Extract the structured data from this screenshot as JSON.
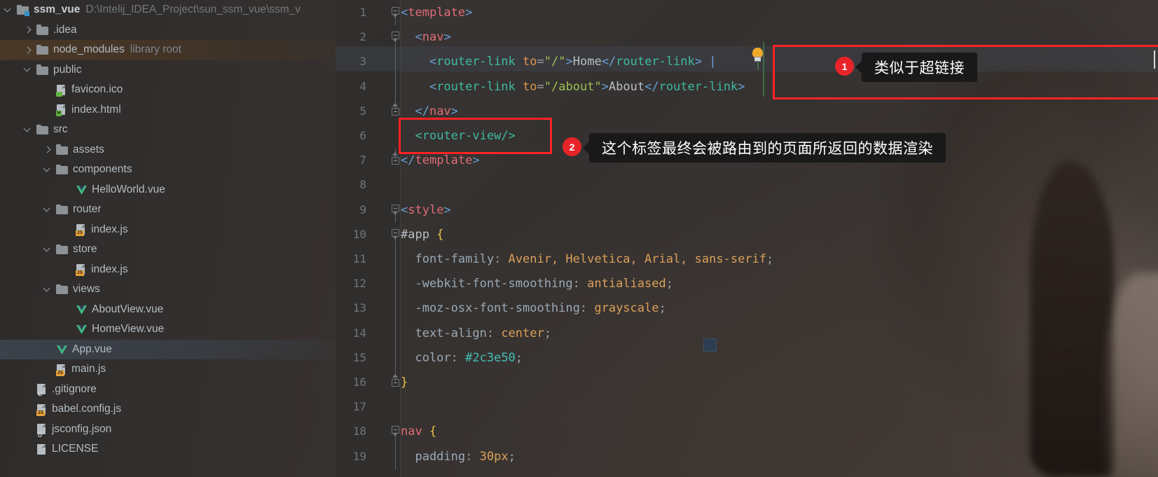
{
  "sidebar": {
    "items": [
      {
        "indent": 0,
        "arrow": "down",
        "icon": "module-folder-icon",
        "label": "ssm_vue",
        "bold": true,
        "path": "D:\\Intelij_IDEA_Project\\sun_ssm_vue\\ssm_v",
        "hint": "",
        "state": "normal"
      },
      {
        "indent": 1,
        "arrow": "right",
        "icon": "folder-icon",
        "label": ".idea",
        "bold": false,
        "path": "",
        "hint": "",
        "state": "normal"
      },
      {
        "indent": 1,
        "arrow": "right",
        "icon": "folder-icon",
        "label": "node_modules",
        "bold": false,
        "path": "",
        "hint": "library root",
        "state": "highlighted"
      },
      {
        "indent": 1,
        "arrow": "down",
        "icon": "folder-icon",
        "label": "public",
        "bold": false,
        "path": "",
        "hint": "",
        "state": "normal"
      },
      {
        "indent": 2,
        "arrow": "none",
        "icon": "image-file-icon",
        "label": "favicon.ico",
        "bold": false,
        "path": "",
        "hint": "",
        "state": "normal"
      },
      {
        "indent": 2,
        "arrow": "none",
        "icon": "html-file-icon",
        "label": "index.html",
        "bold": false,
        "path": "",
        "hint": "",
        "state": "normal"
      },
      {
        "indent": 1,
        "arrow": "down",
        "icon": "folder-icon",
        "label": "src",
        "bold": false,
        "path": "",
        "hint": "",
        "state": "normal"
      },
      {
        "indent": 2,
        "arrow": "right",
        "icon": "folder-icon",
        "label": "assets",
        "bold": false,
        "path": "",
        "hint": "",
        "state": "normal"
      },
      {
        "indent": 2,
        "arrow": "down",
        "icon": "folder-icon",
        "label": "components",
        "bold": false,
        "path": "",
        "hint": "",
        "state": "normal"
      },
      {
        "indent": 3,
        "arrow": "none",
        "icon": "vue-file-icon",
        "label": "HelloWorld.vue",
        "bold": false,
        "path": "",
        "hint": "",
        "state": "normal"
      },
      {
        "indent": 2,
        "arrow": "down",
        "icon": "folder-icon",
        "label": "router",
        "bold": false,
        "path": "",
        "hint": "",
        "state": "normal"
      },
      {
        "indent": 3,
        "arrow": "none",
        "icon": "js-file-icon",
        "label": "index.js",
        "bold": false,
        "path": "",
        "hint": "",
        "state": "normal"
      },
      {
        "indent": 2,
        "arrow": "down",
        "icon": "folder-icon",
        "label": "store",
        "bold": false,
        "path": "",
        "hint": "",
        "state": "normal"
      },
      {
        "indent": 3,
        "arrow": "none",
        "icon": "js-file-icon",
        "label": "index.js",
        "bold": false,
        "path": "",
        "hint": "",
        "state": "normal"
      },
      {
        "indent": 2,
        "arrow": "down",
        "icon": "folder-icon",
        "label": "views",
        "bold": false,
        "path": "",
        "hint": "",
        "state": "normal"
      },
      {
        "indent": 3,
        "arrow": "none",
        "icon": "vue-file-icon",
        "label": "AboutView.vue",
        "bold": false,
        "path": "",
        "hint": "",
        "state": "normal"
      },
      {
        "indent": 3,
        "arrow": "none",
        "icon": "vue-file-icon",
        "label": "HomeView.vue",
        "bold": false,
        "path": "",
        "hint": "",
        "state": "normal"
      },
      {
        "indent": 2,
        "arrow": "none",
        "icon": "vue-file-icon",
        "label": "App.vue",
        "bold": false,
        "path": "",
        "hint": "",
        "state": "selected"
      },
      {
        "indent": 2,
        "arrow": "none",
        "icon": "js-file-icon",
        "label": "main.js",
        "bold": false,
        "path": "",
        "hint": "",
        "state": "normal"
      },
      {
        "indent": 1,
        "arrow": "none",
        "icon": "gitignore-file-icon",
        "label": ".gitignore",
        "bold": false,
        "path": "",
        "hint": "",
        "state": "normal"
      },
      {
        "indent": 1,
        "arrow": "none",
        "icon": "js-file-icon",
        "label": "babel.config.js",
        "bold": false,
        "path": "",
        "hint": "",
        "state": "normal"
      },
      {
        "indent": 1,
        "arrow": "none",
        "icon": "json-file-icon",
        "label": "jsconfig.json",
        "bold": false,
        "path": "",
        "hint": "",
        "state": "normal"
      },
      {
        "indent": 1,
        "arrow": "none",
        "icon": "text-file-icon",
        "label": "LICENSE",
        "bold": false,
        "path": "",
        "hint": "",
        "state": "normal"
      }
    ]
  },
  "editor": {
    "filename": "App.vue",
    "lines": [
      {
        "n": "1",
        "fold": "start",
        "tokens": [
          {
            "t": "<",
            "c": "s-punct"
          },
          {
            "t": "template",
            "c": "s-tagpink"
          },
          {
            "t": ">",
            "c": "s-punct"
          }
        ]
      },
      {
        "n": "2",
        "fold": "start",
        "tokens": [
          {
            "t": "  <",
            "c": "s-punct"
          },
          {
            "t": "nav",
            "c": "s-tagpink"
          },
          {
            "t": ">",
            "c": "s-punct"
          }
        ]
      },
      {
        "n": "3",
        "fold": "stem",
        "tokens": [
          {
            "t": "    <",
            "c": "s-punct"
          },
          {
            "t": "router-link",
            "c": "s-tag"
          },
          {
            "t": " ",
            "c": "s-eq"
          },
          {
            "t": "to",
            "c": "s-attr"
          },
          {
            "t": "=",
            "c": "s-eq"
          },
          {
            "t": "\"/\"",
            "c": "s-str"
          },
          {
            "t": ">",
            "c": "s-punct"
          },
          {
            "t": "Home",
            "c": "s-text"
          },
          {
            "t": "</",
            "c": "s-punct"
          },
          {
            "t": "router-link",
            "c": "s-tag"
          },
          {
            "t": ">",
            "c": "s-punct"
          },
          {
            "t": " ",
            "c": "s-eq"
          },
          {
            "t": "|",
            "c": "s-punct"
          }
        ]
      },
      {
        "n": "4",
        "fold": "stem",
        "tokens": [
          {
            "t": "    <",
            "c": "s-punct"
          },
          {
            "t": "router-link",
            "c": "s-tag"
          },
          {
            "t": " ",
            "c": "s-eq"
          },
          {
            "t": "to",
            "c": "s-attr"
          },
          {
            "t": "=",
            "c": "s-eq"
          },
          {
            "t": "\"/about\"",
            "c": "s-str"
          },
          {
            "t": ">",
            "c": "s-punct"
          },
          {
            "t": "About",
            "c": "s-text"
          },
          {
            "t": "</",
            "c": "s-punct"
          },
          {
            "t": "router-link",
            "c": "s-tag"
          },
          {
            "t": ">",
            "c": "s-punct"
          }
        ]
      },
      {
        "n": "5",
        "fold": "end",
        "tokens": [
          {
            "t": "  </",
            "c": "s-punct"
          },
          {
            "t": "nav",
            "c": "s-tagpink"
          },
          {
            "t": ">",
            "c": "s-punct"
          }
        ]
      },
      {
        "n": "6",
        "fold": "none",
        "tokens": [
          {
            "t": "  <",
            "c": "s-tag"
          },
          {
            "t": "router-view",
            "c": "s-tag"
          },
          {
            "t": "/>",
            "c": "s-tag"
          }
        ]
      },
      {
        "n": "7",
        "fold": "end",
        "tokens": [
          {
            "t": "</",
            "c": "s-punct"
          },
          {
            "t": "template",
            "c": "s-tagpink"
          },
          {
            "t": ">",
            "c": "s-punct"
          }
        ]
      },
      {
        "n": "8",
        "fold": "none",
        "tokens": []
      },
      {
        "n": "9",
        "fold": "start",
        "tokens": [
          {
            "t": "<",
            "c": "s-punct"
          },
          {
            "t": "style",
            "c": "s-tagpink"
          },
          {
            "t": ">",
            "c": "s-punct"
          }
        ]
      },
      {
        "n": "10",
        "fold": "start",
        "tokens": [
          {
            "t": "#app",
            "c": "s-text"
          },
          {
            "t": " ",
            "c": "s-eq"
          },
          {
            "t": "{",
            "c": "s-brace"
          }
        ]
      },
      {
        "n": "11",
        "fold": "stem",
        "tokens": [
          {
            "t": "  font-family",
            "c": "s-prop"
          },
          {
            "t": ": ",
            "c": "s-eq"
          },
          {
            "t": "Avenir, Helvetica, Arial, sans-serif",
            "c": "s-val"
          },
          {
            "t": ";",
            "c": "s-eq"
          }
        ]
      },
      {
        "n": "12",
        "fold": "stem",
        "tokens": [
          {
            "t": "  -webkit-font-smoothing",
            "c": "s-prop"
          },
          {
            "t": ": ",
            "c": "s-eq"
          },
          {
            "t": "antialiased",
            "c": "s-val"
          },
          {
            "t": ";",
            "c": "s-eq"
          }
        ]
      },
      {
        "n": "13",
        "fold": "stem",
        "tokens": [
          {
            "t": "  -moz-osx-font-smoothing",
            "c": "s-prop"
          },
          {
            "t": ": ",
            "c": "s-eq"
          },
          {
            "t": "grayscale",
            "c": "s-val"
          },
          {
            "t": ";",
            "c": "s-eq"
          }
        ]
      },
      {
        "n": "14",
        "fold": "stem",
        "tokens": [
          {
            "t": "  text-align",
            "c": "s-prop"
          },
          {
            "t": ": ",
            "c": "s-eq"
          },
          {
            "t": "center",
            "c": "s-val"
          },
          {
            "t": ";",
            "c": "s-eq"
          }
        ]
      },
      {
        "n": "15",
        "fold": "stem",
        "tokens": [
          {
            "t": "  color",
            "c": "s-prop"
          },
          {
            "t": ": ",
            "c": "s-eq"
          },
          {
            "t": "#2c3e50",
            "c": "s-hash"
          },
          {
            "t": ";",
            "c": "s-eq"
          }
        ]
      },
      {
        "n": "16",
        "fold": "end",
        "tokens": [
          {
            "t": "}",
            "c": "s-brace"
          }
        ]
      },
      {
        "n": "17",
        "fold": "none",
        "tokens": []
      },
      {
        "n": "18",
        "fold": "start",
        "tokens": [
          {
            "t": "nav",
            "c": "s-sel"
          },
          {
            "t": " ",
            "c": "s-eq"
          },
          {
            "t": "{",
            "c": "s-brace"
          }
        ]
      },
      {
        "n": "19",
        "fold": "stem",
        "tokens": [
          {
            "t": "  padding",
            "c": "s-prop"
          },
          {
            "t": ": ",
            "c": "s-eq"
          },
          {
            "t": "30px",
            "c": "s-val"
          },
          {
            "t": ";",
            "c": "s-eq"
          }
        ]
      }
    ]
  },
  "annotations": {
    "one": {
      "number": "1",
      "text": "类似于超链接"
    },
    "two": {
      "number": "2",
      "text": "这个标签最终会被路由到的页面所返回的数据渲染"
    }
  },
  "colors": {
    "annotation_red": "#fb2323",
    "marker_red": "#e8242a",
    "tooltip_bg": "#191919",
    "swatch": "#2c3e50",
    "vue_green": "#41b883",
    "js_badge": "#e8a33d",
    "html_badge": "#62b543"
  }
}
